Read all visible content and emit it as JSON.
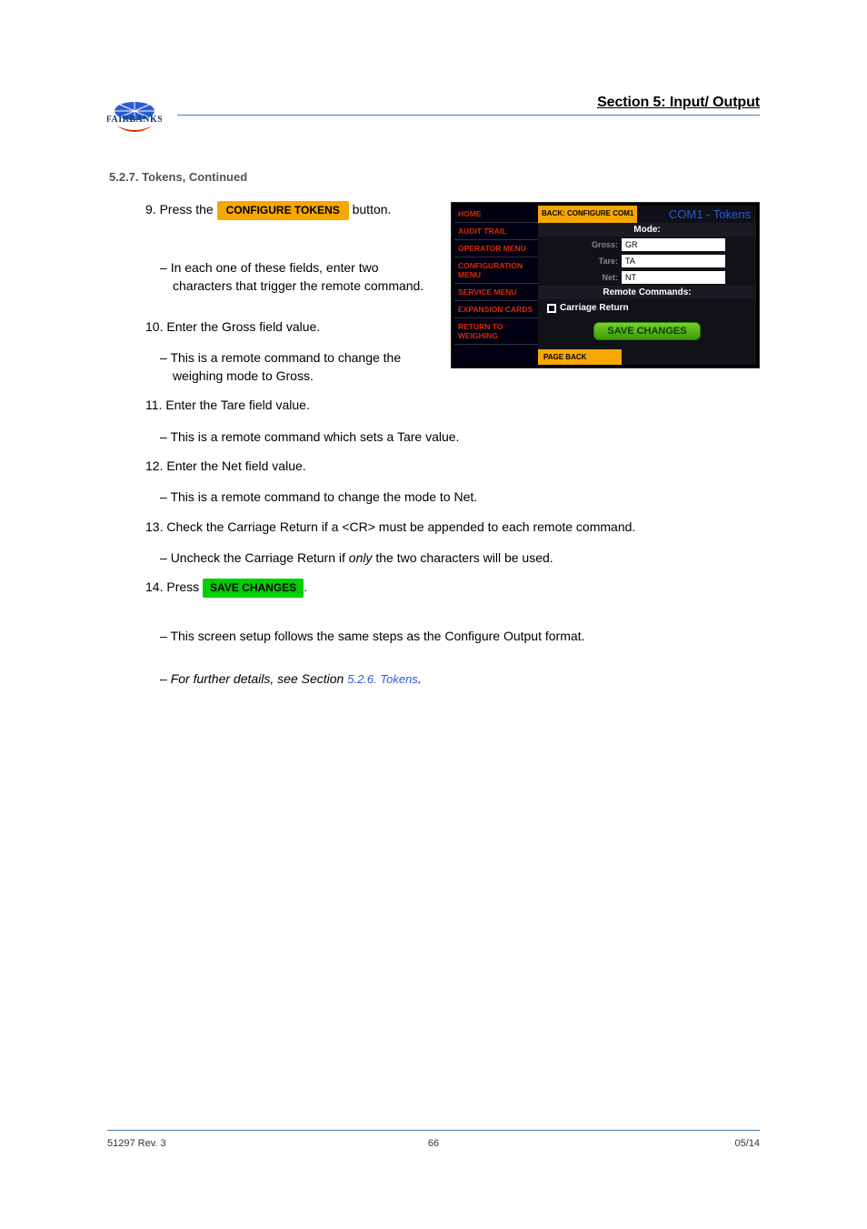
{
  "header": {
    "section_title": "Section 5: Input/ Output",
    "logo_text": "FAIRBANKS"
  },
  "subheading": "5.2.7. Tokens, Continued",
  "body": {
    "step9_prefix": "9. Press the",
    "step9_btn": "CONFIGURE TOKENS",
    "step9_suffix": "button.",
    "dash1": "In each one of these fields, enter two characters that trigger the remote command.",
    "step10": "10. Enter the Gross field value.",
    "dash2": "This is a remote command to change the weighing mode to Gross.",
    "step11": "11. Enter the Tare field value.",
    "dash3": "This is a remote command which sets a Tare value.",
    "step12": "12. Enter the Net field value.",
    "dash4": "This is a remote command to change the mode to Net.",
    "step13": "13. Check the Carriage Return if a <CR> must be appended to each remote command.",
    "dash5_prefix": "Uncheck the Carriage Return if",
    "dash5_em": "only",
    "dash5_suffix": "the two characters will be used.",
    "step14_prefix": "14. Press",
    "step14_btn": "SAVE CHANGES",
    "step14_suffix": ".",
    "dash6": "This screen setup follows the same steps as the Configure Output format.",
    "dash7_prefix": "For further details, see Section",
    "dash7_link": "5.2.6. Tokens"
  },
  "screenshot": {
    "sidebar": [
      "HOME",
      "AUDIT TRAIL",
      "OPERATOR MENU",
      "CONFIGURATION MENU",
      "SERVICE MENU",
      "EXPANSION CARDS",
      "RETURN TO WEIGHING"
    ],
    "back_configure": "BACK: CONFIGURE COM1",
    "top_title": "COM1 - Tokens",
    "mode_label": "Mode:",
    "gross_label": "Gross:",
    "gross_value": "GR",
    "tare_label": "Tare:",
    "tare_value": "TA",
    "net_label": "Net:",
    "net_value": "NT",
    "remote_label": "Remote Commands:",
    "carriage_label": "Carriage Return",
    "save_changes": "SAVE CHANGES",
    "page_back": "PAGE BACK"
  },
  "footer": {
    "left": "51297 Rev. 3",
    "center": "66",
    "right": "05/14"
  }
}
